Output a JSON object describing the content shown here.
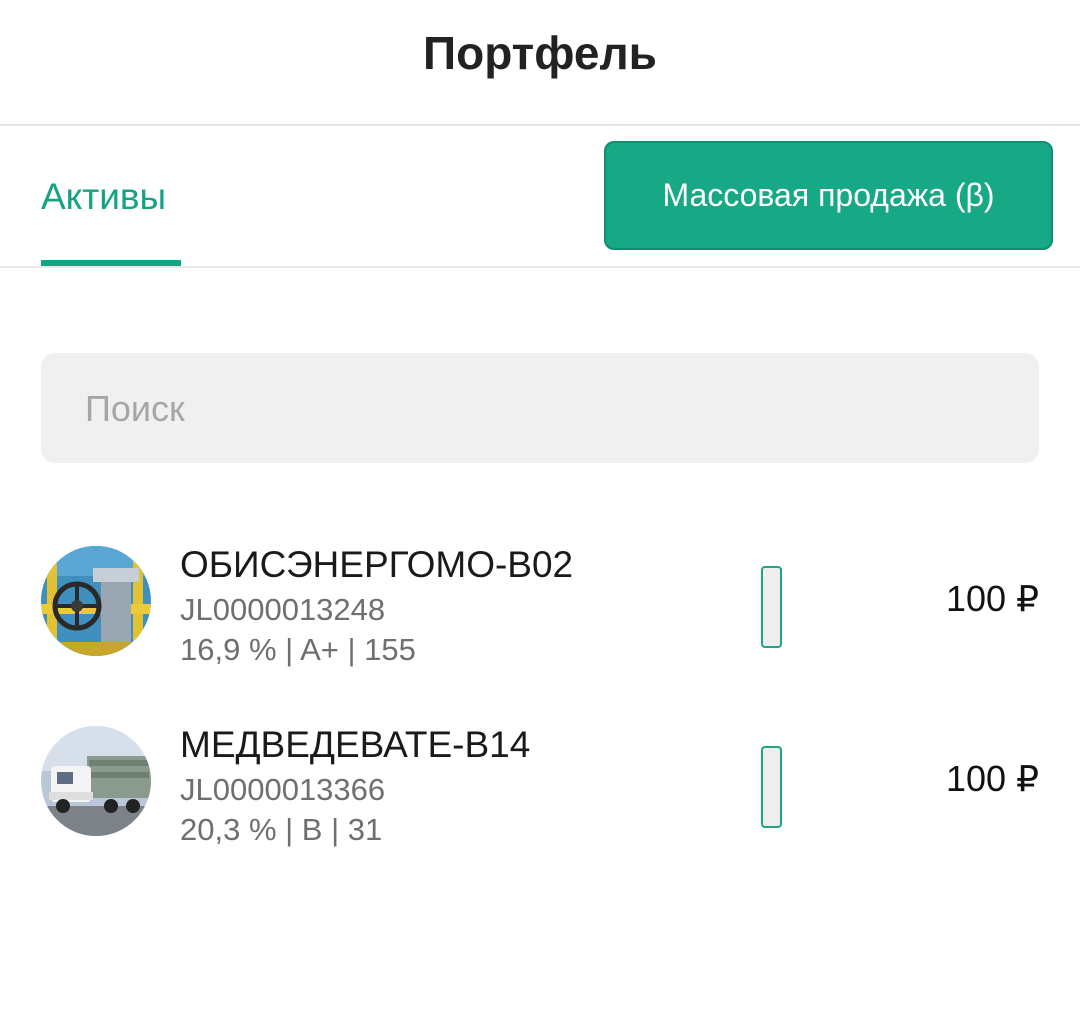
{
  "header": {
    "title": "Портфель"
  },
  "tabs": {
    "active_label": "Активы"
  },
  "actions": {
    "mass_sell_label": "Массовая продажа (β)"
  },
  "search": {
    "placeholder": "Поиск",
    "value": ""
  },
  "colors": {
    "accent": "#14a383",
    "button_bg": "#17a885",
    "search_bg": "#f0f0f0"
  },
  "assets": [
    {
      "name": "ОБИСЭНЕРГОМО-В02",
      "id": "JL0000013248",
      "meta": "16,9 % | A+ | 155",
      "price": "100 ₽",
      "avatar_icon": "industrial-valve-photo"
    },
    {
      "name": "МЕДВЕДЕВАТЕ-В14",
      "id": "JL0000013366",
      "meta": "20,3 % | B | 31",
      "price": "100 ₽",
      "avatar_icon": "truck-photo"
    }
  ]
}
